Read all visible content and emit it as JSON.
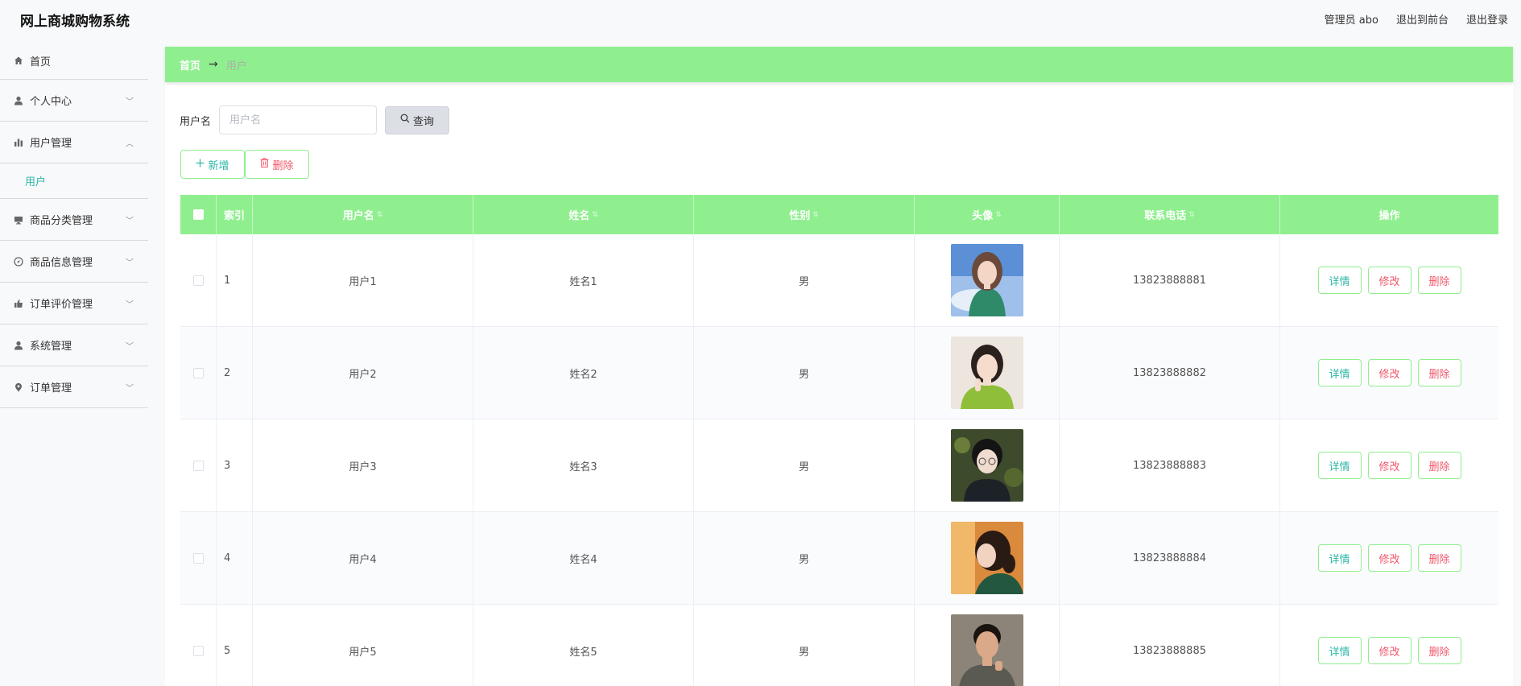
{
  "app": {
    "title": "网上商城购物系统"
  },
  "header": {
    "admin_label": "管理员 abo",
    "to_front": "退出到前台",
    "logout": "退出登录"
  },
  "sidebar": {
    "items": [
      {
        "label": "首页",
        "icon": "home-icon"
      },
      {
        "label": "个人中心",
        "icon": "user-icon"
      },
      {
        "label": "用户管理",
        "icon": "bar-chart-icon",
        "expanded": true,
        "children": [
          {
            "label": "用户"
          }
        ]
      },
      {
        "label": "商品分类管理",
        "icon": "monitor-icon"
      },
      {
        "label": "商品信息管理",
        "icon": "compass-icon"
      },
      {
        "label": "订单评价管理",
        "icon": "thumbs-up-icon"
      },
      {
        "label": "系统管理",
        "icon": "user-icon"
      },
      {
        "label": "订单管理",
        "icon": "map-pin-icon"
      }
    ]
  },
  "breadcrumb": {
    "home": "首页",
    "separator": "→",
    "current": "用户"
  },
  "search": {
    "label": "用户名",
    "placeholder": "用户名",
    "value": "",
    "button": "查询"
  },
  "actions": {
    "add": "新增",
    "delete": "删除"
  },
  "table": {
    "columns": [
      "索引",
      "用户名",
      "姓名",
      "性别",
      "头像",
      "联系电话",
      "操作"
    ],
    "rows": [
      {
        "index": "1",
        "username": "用户1",
        "name": "姓名1",
        "gender": "男",
        "phone": "13823888881"
      },
      {
        "index": "2",
        "username": "用户2",
        "name": "姓名2",
        "gender": "男",
        "phone": "13823888882"
      },
      {
        "index": "3",
        "username": "用户3",
        "name": "姓名3",
        "gender": "男",
        "phone": "13823888883"
      },
      {
        "index": "4",
        "username": "用户4",
        "name": "姓名4",
        "gender": "男",
        "phone": "13823888884"
      },
      {
        "index": "5",
        "username": "用户5",
        "name": "姓名5",
        "gender": "男",
        "phone": "13823888885"
      }
    ],
    "row_actions": {
      "detail": "详情",
      "edit": "修改",
      "delete": "删除"
    }
  },
  "colors": {
    "accent_green": "#8fef8f",
    "teal_text": "#2bb6a6",
    "danger_text": "#f0576b"
  }
}
